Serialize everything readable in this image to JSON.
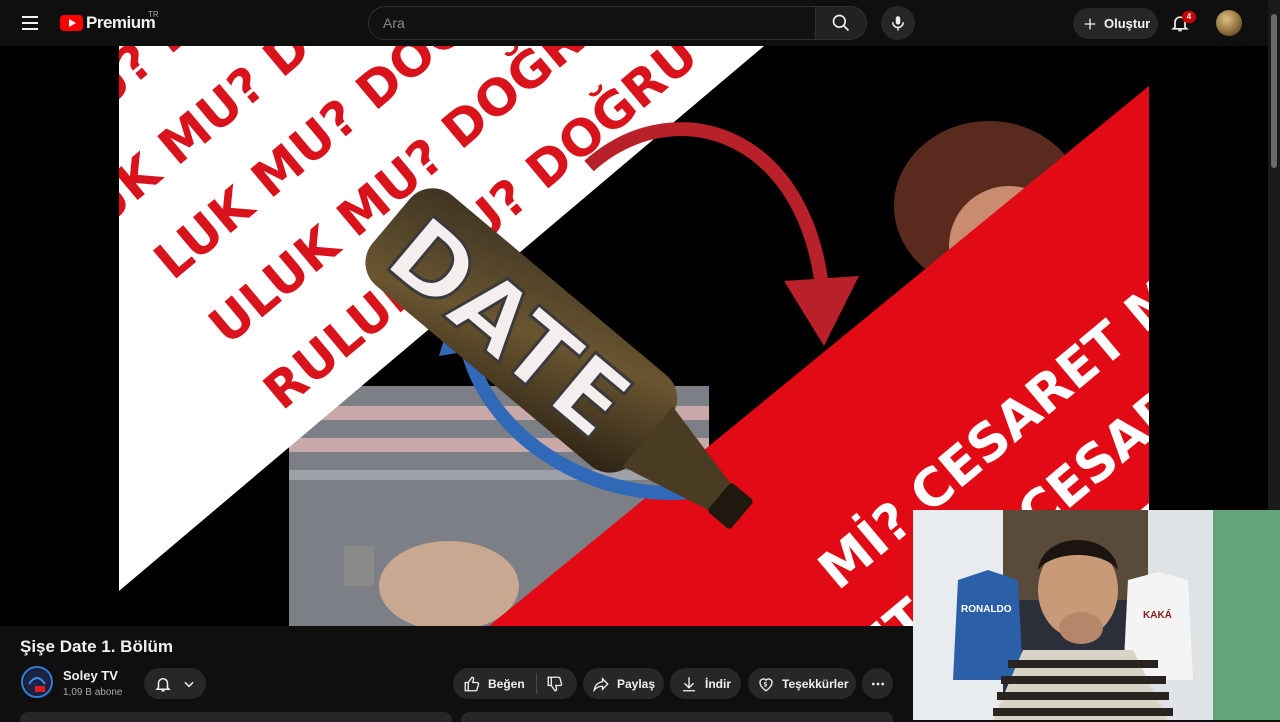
{
  "header": {
    "logo_text": "Premium",
    "region": "TR",
    "search_placeholder": "Ara",
    "create_label": "Oluştur",
    "notification_count": "4"
  },
  "video": {
    "title": "Şişe Date 1. Bölüm",
    "thumbnail_texts": {
      "bottle": "DATE",
      "left": "DOĞRULUK MU?",
      "right": "CESARET Mİ?"
    }
  },
  "channel": {
    "name": "Soley TV",
    "subscribers": "1,09 B abone"
  },
  "actions": {
    "like": "Beğen",
    "share": "Paylaş",
    "download": "İndir",
    "thanks": "Teşekkürler"
  },
  "webcam": {
    "jersey_text_1": "RONALDO",
    "jersey_text_2": "KAKÁ"
  },
  "colors": {
    "background": "#0f0f0f",
    "button": "#272727",
    "brand_red": "#ff0000",
    "thumb_red": "#e20a14"
  },
  "icons": [
    "menu-icon",
    "youtube-logo-icon",
    "search-icon",
    "mic-icon",
    "plus-icon",
    "bell-icon",
    "like-icon",
    "dislike-icon",
    "share-icon",
    "download-icon",
    "thanks-icon",
    "more-icon",
    "chevron-down-icon"
  ]
}
